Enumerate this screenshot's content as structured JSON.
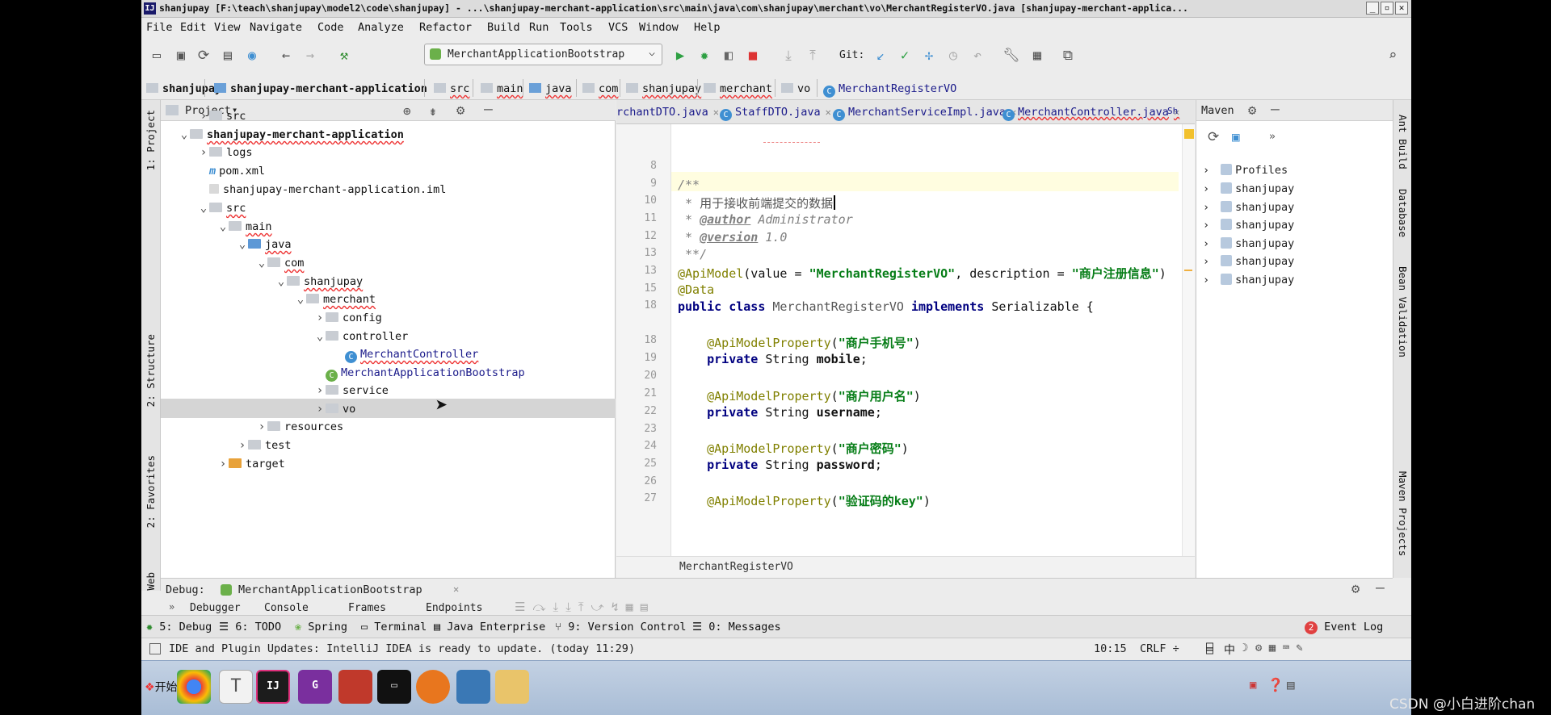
{
  "window": {
    "title": "shanjupay [F:\\teach\\shanjupay\\model2\\code\\shanjupay] - ...\\shanjupay-merchant-application\\src\\main\\java\\com\\shanjupay\\merchant\\vo\\MerchantRegisterVO.java [shanjupay-merchant-applica...",
    "controls": [
      "_",
      "▫",
      "✕"
    ]
  },
  "menu": [
    "File",
    "Edit",
    "View",
    "Navigate",
    "Code",
    "Analyze",
    "Refactor",
    "Build",
    "Run",
    "Tools",
    "VCS",
    "Window",
    "Help"
  ],
  "toolbar": {
    "run_config": "MerchantApplicationBootstrap",
    "git_label": "Git:"
  },
  "breadcrumb": [
    "shanjupay",
    "shanjupay-merchant-application",
    "src",
    "main",
    "java",
    "com",
    "shanjupay",
    "merchant",
    "vo",
    "MerchantRegisterVO"
  ],
  "left_strip": {
    "project": "1: Project",
    "structure": "2: Structure",
    "favorites": "2: Favorites",
    "web": "Web"
  },
  "project_panel": {
    "title": "Project",
    "tree": [
      {
        "label": "src",
        "depth": 1,
        "arrow": "▸",
        "icon": "folder"
      },
      {
        "label": "shanjupay-merchant-application",
        "depth": 0,
        "arrow": "▾",
        "icon": "module"
      },
      {
        "label": "logs",
        "depth": 1,
        "arrow": "▸",
        "icon": "folder"
      },
      {
        "label": "pom.xml",
        "depth": 1,
        "arrow": "",
        "icon": "maven"
      },
      {
        "label": "shanjupay-merchant-application.iml",
        "depth": 1,
        "arrow": "",
        "icon": "file"
      },
      {
        "label": "src",
        "depth": 1,
        "arrow": "▾",
        "icon": "folder"
      },
      {
        "label": "main",
        "depth": 2,
        "arrow": "▾",
        "icon": "folder"
      },
      {
        "label": "java",
        "depth": 3,
        "arrow": "▾",
        "icon": "folder-blue"
      },
      {
        "label": "com",
        "depth": 4,
        "arrow": "▾",
        "icon": "folder"
      },
      {
        "label": "shanjupay",
        "depth": 5,
        "arrow": "▾",
        "icon": "folder"
      },
      {
        "label": "merchant",
        "depth": 6,
        "arrow": "▾",
        "icon": "folder"
      },
      {
        "label": "config",
        "depth": 7,
        "arrow": "▸",
        "icon": "folder"
      },
      {
        "label": "controller",
        "depth": 7,
        "arrow": "▾",
        "icon": "folder"
      },
      {
        "label": "MerchantController",
        "depth": 8,
        "arrow": "",
        "icon": "class"
      },
      {
        "label": "MerchantApplicationBootstrap",
        "depth": 7,
        "arrow": "",
        "icon": "boot"
      },
      {
        "label": "service",
        "depth": 7,
        "arrow": "▸",
        "icon": "folder"
      },
      {
        "label": "vo",
        "depth": 7,
        "arrow": "▸",
        "icon": "folder"
      },
      {
        "label": "resources",
        "depth": 4,
        "arrow": "▸",
        "icon": "folder"
      },
      {
        "label": "test",
        "depth": 3,
        "arrow": "▸",
        "icon": "folder"
      },
      {
        "label": "target",
        "depth": 2,
        "arrow": "▸",
        "icon": "folder-orange"
      }
    ]
  },
  "editor": {
    "tabs": [
      "rchantDTO.java",
      "StaffDTO.java",
      "MerchantServiceImpl.java",
      "MerchantController.java",
      "Sh"
    ],
    "lines": [
      {
        "n": "8",
        "html": ""
      },
      {
        "n": "9",
        "html": "<span class='cmt'>/**</span>"
      },
      {
        "n": "10",
        "html": "<span class='cmt'> * </span><span style='color:#555'>用于接收前端提交的数据</span>"
      },
      {
        "n": "11",
        "html": "<span class='cmt'> * </span><span class='doctag'>@author</span><span class='cmt'> Administrator</span>"
      },
      {
        "n": "12",
        "html": "<span class='cmt'> * </span><span class='doctag'>@version</span><span class='cmt'> 1.0</span>"
      },
      {
        "n": "13",
        "html": "<span class='cmt'> **/</span>"
      },
      {
        "n": "13",
        "html": "<span class='ann'>@ApiModel</span>(value = <span class='str'>\"MerchantRegisterVO\"</span>, description = <span class='str'>\"商户注册信息\"</span>)"
      },
      {
        "n": "15",
        "html": "<span class='ann'>@Data</span>"
      },
      {
        "n": "18",
        "html": "<span class='kw'>public class</span> <span class='gray'>MerchantRegisterVO</span> <span class='kw'>implements</span> Serializable {"
      },
      {
        "n": "",
        "html": ""
      },
      {
        "n": "18",
        "html": "    <span class='ann'>@ApiModelProperty</span>(<span class='str'>\"商户手机号\"</span>)"
      },
      {
        "n": "19",
        "html": "    <span class='kw'>private</span> String <span style='font-weight:bold'>mobile</span>;"
      },
      {
        "n": "20",
        "html": ""
      },
      {
        "n": "21",
        "html": "    <span class='ann'>@ApiModelProperty</span>(<span class='str'>\"商户用户名\"</span>)"
      },
      {
        "n": "22",
        "html": "    <span class='kw'>private</span> String <span style='font-weight:bold'>username</span>;"
      },
      {
        "n": "23",
        "html": ""
      },
      {
        "n": "24",
        "html": "    <span class='ann'>@ApiModelProperty</span>(<span class='str'>\"商户密码\"</span>)"
      },
      {
        "n": "25",
        "html": "    <span class='kw'>private</span> String <span style='font-weight:bold'>password</span>;"
      },
      {
        "n": "26",
        "html": ""
      },
      {
        "n": "27",
        "html": "    <span class='ann'>@ApiModelProperty</span>(<span class='str'>\"验证码的key\"</span>)"
      }
    ],
    "footer": "MerchantRegisterVO"
  },
  "maven": {
    "title": "Maven",
    "profiles": "Profiles",
    "items": [
      "shanjupay",
      "shanjupay",
      "shanjupay",
      "shanjupay",
      "shanjupay",
      "shanjupay"
    ]
  },
  "right_strip": {
    "ant": "Ant Build",
    "database": "Database",
    "bean": "Bean Validation",
    "maven_projects": "Maven Projects"
  },
  "debug": {
    "label": "Debug:",
    "config": "MerchantApplicationBootstrap",
    "tabs": [
      "Debugger",
      "Console",
      "Frames",
      "Endpoints"
    ]
  },
  "tool_windows": {
    "debug": "5: Debug",
    "todo": "6: TODO",
    "spring": "Spring",
    "terminal": "Terminal",
    "java_ee": "Java Enterprise",
    "vcs": "9: Version Control",
    "messages": "0: Messages",
    "event_log": "Event Log",
    "event_count": "2"
  },
  "status": {
    "message": "IDE and Plugin Updates: IntelliJ IDEA is ready to update. (today 11:29)",
    "position": "10:15",
    "line_sep": "CRLF ÷",
    "ime": "中"
  },
  "taskbar": {
    "start": "开始"
  },
  "watermark": "CSDN @小白进阶chan",
  "colors": {
    "accent": "#3f8fd2",
    "keyword": "#000080",
    "string": "#067d17",
    "annotation": "#808000"
  }
}
